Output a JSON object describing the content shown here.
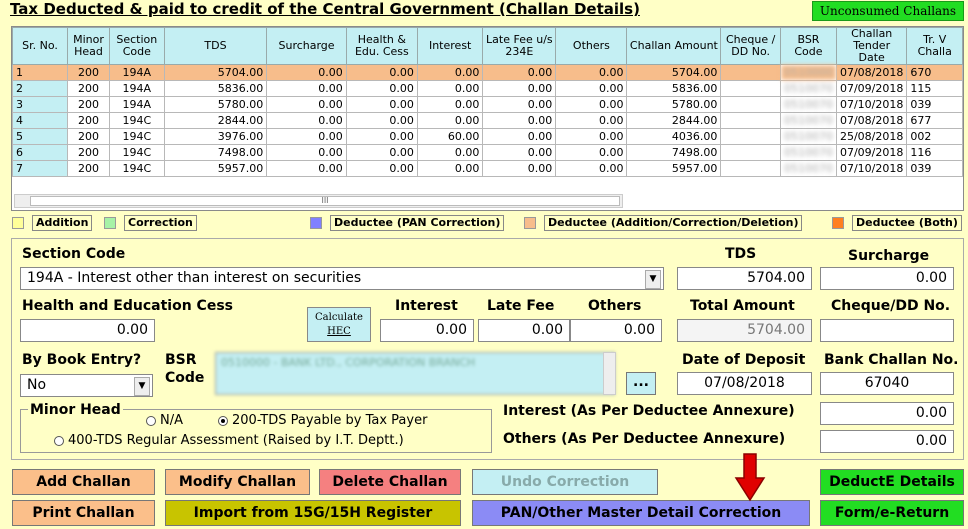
{
  "title": "Tax Deducted & paid to credit of the Central Government (Challan Details)",
  "unconsumed_label": "Unconsumed Challans",
  "columns": [
    "Sr. No.",
    "Minor Head",
    "Section Code",
    "TDS",
    "Surcharge",
    "Health & Edu. Cess",
    "Interest",
    "Late Fee u/s 234E",
    "Others",
    "Challan Amount",
    "Cheque / DD No.",
    "BSR Code",
    "Challan Tender Date",
    "Tr. V Challa"
  ],
  "rows": [
    {
      "sr": "1",
      "minor": "200",
      "section": "194A",
      "tds": "5704.00",
      "surcharge": "0.00",
      "cess": "0.00",
      "interest": "0.00",
      "late": "0.00",
      "others": "0.00",
      "amount": "5704.00",
      "cheque": "",
      "bsr": "0510000",
      "date": "07/08/2018",
      "trv": "670"
    },
    {
      "sr": "2",
      "minor": "200",
      "section": "194A",
      "tds": "5836.00",
      "surcharge": "0.00",
      "cess": "0.00",
      "interest": "0.00",
      "late": "0.00",
      "others": "0.00",
      "amount": "5836.00",
      "cheque": "",
      "bsr": "0510070",
      "date": "07/09/2018",
      "trv": "115"
    },
    {
      "sr": "3",
      "minor": "200",
      "section": "194A",
      "tds": "5780.00",
      "surcharge": "0.00",
      "cess": "0.00",
      "interest": "0.00",
      "late": "0.00",
      "others": "0.00",
      "amount": "5780.00",
      "cheque": "",
      "bsr": "0510070",
      "date": "07/10/2018",
      "trv": "039"
    },
    {
      "sr": "4",
      "minor": "200",
      "section": "194C",
      "tds": "2844.00",
      "surcharge": "0.00",
      "cess": "0.00",
      "interest": "0.00",
      "late": "0.00",
      "others": "0.00",
      "amount": "2844.00",
      "cheque": "",
      "bsr": "0510070",
      "date": "07/08/2018",
      "trv": "677"
    },
    {
      "sr": "5",
      "minor": "200",
      "section": "194C",
      "tds": "3976.00",
      "surcharge": "0.00",
      "cess": "0.00",
      "interest": "60.00",
      "late": "0.00",
      "others": "0.00",
      "amount": "4036.00",
      "cheque": "",
      "bsr": "0510070",
      "date": "25/08/2018",
      "trv": "002"
    },
    {
      "sr": "6",
      "minor": "200",
      "section": "194C",
      "tds": "7498.00",
      "surcharge": "0.00",
      "cess": "0.00",
      "interest": "0.00",
      "late": "0.00",
      "others": "0.00",
      "amount": "7498.00",
      "cheque": "",
      "bsr": "0510070",
      "date": "07/09/2018",
      "trv": "116"
    },
    {
      "sr": "7",
      "minor": "200",
      "section": "194C",
      "tds": "5957.00",
      "surcharge": "0.00",
      "cess": "0.00",
      "interest": "0.00",
      "late": "0.00",
      "others": "0.00",
      "amount": "5957.00",
      "cheque": "",
      "bsr": "0510070",
      "date": "07/10/2018",
      "trv": "039"
    }
  ],
  "scroll_glyph": "III",
  "legend": {
    "addition": "Addition",
    "correction": "Correction",
    "pan": "Deductee (PAN Correction)",
    "acd": "Deductee (Addition/Correction/Deletion)",
    "both": "Deductee (Both)",
    "colors": {
      "addition": "#ffff99",
      "correction": "#a6f2a6",
      "pan": "#8080ff",
      "acd": "#f7bd8b",
      "both": "#ff7f1f"
    }
  },
  "form": {
    "section_code_label": "Section Code",
    "section_code_value": "194A - Interest other than interest on securities",
    "tds_label": "TDS",
    "tds_value": "5704.00",
    "surcharge_label": "Surcharge",
    "surcharge_value": "0.00",
    "cess_label": "Health and Education Cess",
    "cess_value": "0.00",
    "calc_label_1": "Calculate",
    "calc_label_2": "HEC",
    "interest_label": "Interest",
    "interest_value": "0.00",
    "latefee_label": "Late Fee",
    "latefee_value": "0.00",
    "others_label": "Others",
    "others_value": "0.00",
    "total_label": "Total Amount",
    "total_value": "5704.00",
    "cheque_label": "Cheque/DD No.",
    "cheque_value": "",
    "book_entry_label": "By Book Entry?",
    "book_entry_value": "No",
    "bsr_label_1": "BSR",
    "bsr_label_2": "Code",
    "bsr_value": "0510000 - BANK LTD., CORPORATION BRANCH",
    "browse_label": "...",
    "deposit_label": "Date of Deposit",
    "deposit_value": "07/08/2018",
    "bank_challan_label": "Bank Challan No.",
    "bank_challan_value": "67040",
    "minor_head_label": "Minor Head",
    "opt_na": "N/A",
    "opt_200": "200-TDS Payable by Tax Payer",
    "opt_400": "400-TDS Regular Assessment (Raised by I.T. Deptt.)",
    "interest_annex_label": "Interest (As Per Deductee Annexure)",
    "interest_annex_value": "0.00",
    "others_annex_label": "Others (As Per Deductee Annexure)",
    "others_annex_value": "0.00"
  },
  "buttons": {
    "add": "Add Challan",
    "modify": "Modify Challan",
    "delete": "Delete Challan",
    "undo": "Undo Correction",
    "deductee": "DeductE Details",
    "print": "Print Challan",
    "import": "Import from 15G/15H Register",
    "pan": "PAN/Other Master Detail Correction",
    "form": "Form/e-Return"
  }
}
